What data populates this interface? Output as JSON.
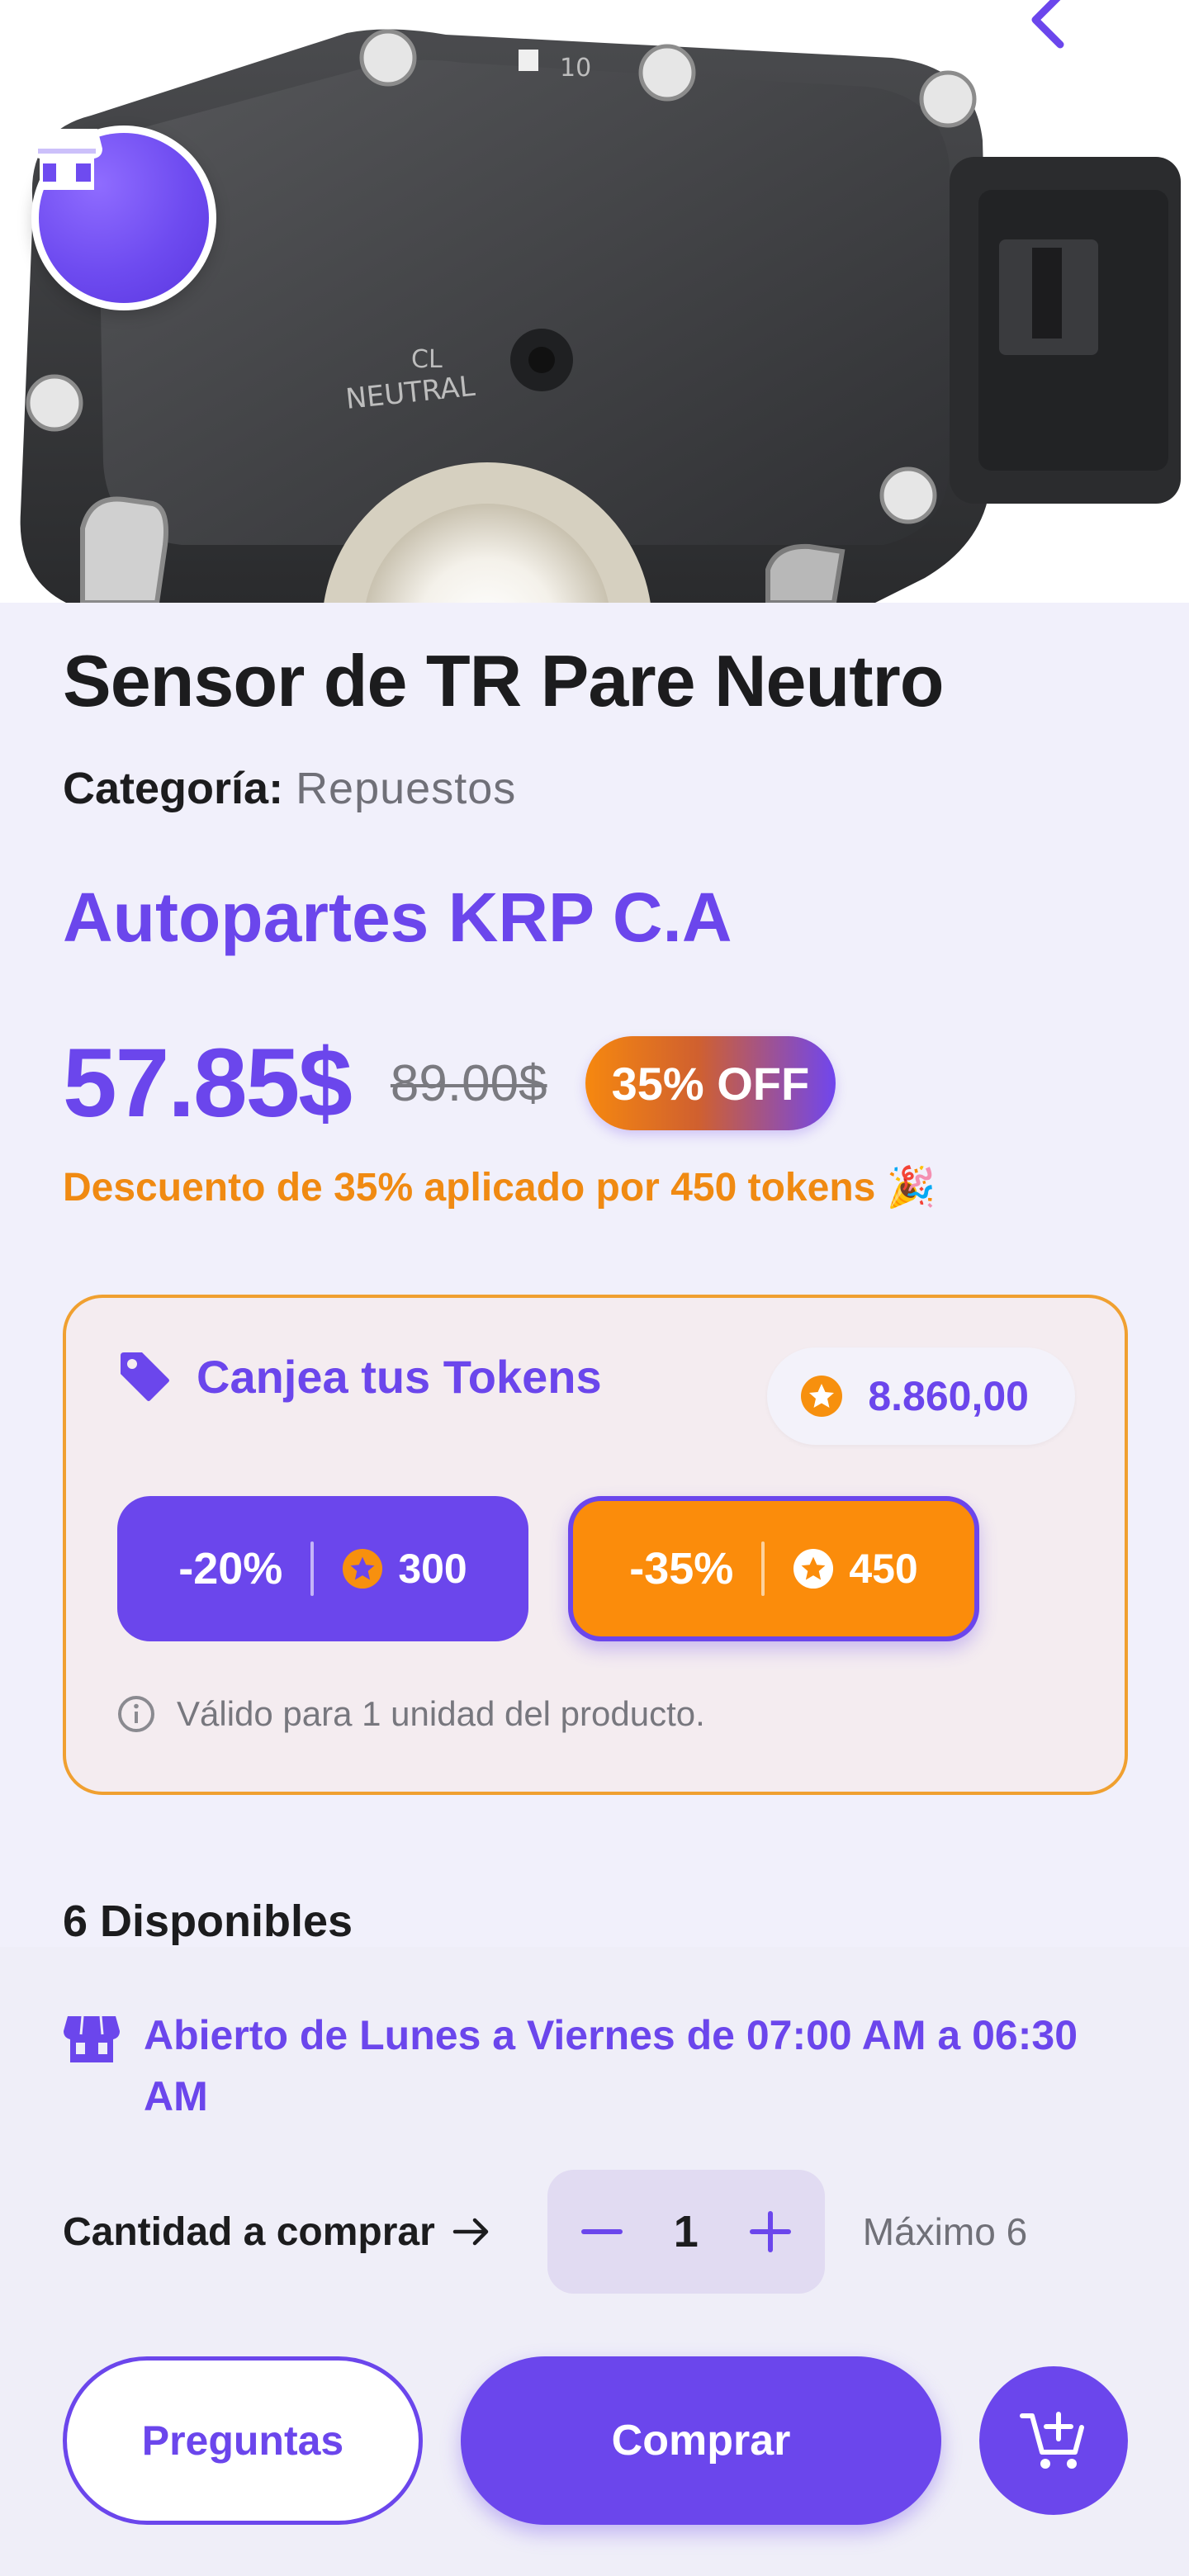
{
  "product": {
    "title": "Sensor de TR Pare Neutro",
    "category_label": "Categoría:",
    "category_value": "Repuestos",
    "store_name": "Autopartes KRP C.A",
    "price": "57.85$",
    "old_price": "89.00$",
    "off_badge": "35% OFF",
    "discount_note": "Descuento de 35% aplicado por 450 tokens 🎉",
    "image_labels": {
      "neutral": "NEUTRAL",
      "mark_10": "10",
      "mark_cl": "CL"
    }
  },
  "tokens": {
    "title": "Canjea tus Tokens",
    "balance": "8.860,00",
    "options": [
      {
        "percent": "-20%",
        "cost": "300",
        "selected": false
      },
      {
        "percent": "-35%",
        "cost": "450",
        "selected": true
      }
    ],
    "note": "Válido para 1 unidad del producto."
  },
  "stock": {
    "available_label": "6 Disponibles"
  },
  "sheet": {
    "hours": "Abierto de Lunes a Viernes de 07:00 AM a 06:30 AM",
    "quantity_label": "Cantidad a comprar",
    "quantity_value": "1",
    "max_label": "Máximo 6",
    "questions_button": "Preguntas",
    "buy_button": "Comprar"
  },
  "icons": {
    "back": "chevron-left-icon",
    "store": "store-icon",
    "tag": "tag-icon",
    "token": "star-coin-icon",
    "info": "info-icon",
    "arrow": "arrow-right-icon",
    "minus": "minus-icon",
    "plus": "plus-icon",
    "cart": "cart-plus-icon"
  },
  "colors": {
    "primary": "#6b46ec",
    "accent": "#fb8c0b",
    "background": "#f1f0fb",
    "text": "#1c1c1e",
    "muted": "#707078"
  }
}
